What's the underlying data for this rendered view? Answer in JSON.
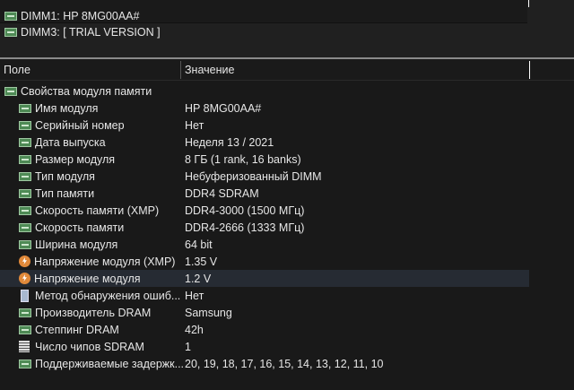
{
  "devices": [
    {
      "label": "DIMM1: HP 8MG00AA#"
    },
    {
      "label": "DIMM3: [ TRIAL VERSION ]"
    }
  ],
  "header": {
    "field": "Поле",
    "value": "Значение"
  },
  "group": {
    "label": "Свойства модуля памяти"
  },
  "rows": [
    {
      "field": "Имя модуля",
      "value": "HP 8MG00AA#",
      "icon": "memory-module-icon"
    },
    {
      "field": "Серийный номер",
      "value": "Нет",
      "icon": "memory-module-icon"
    },
    {
      "field": "Дата выпуска",
      "value": "Неделя 13 / 2021",
      "icon": "memory-module-icon"
    },
    {
      "field": "Размер модуля",
      "value": "8 ГБ (1 rank, 16 banks)",
      "icon": "memory-module-icon"
    },
    {
      "field": "Тип модуля",
      "value": "Небуферизованный DIMM",
      "icon": "memory-module-icon"
    },
    {
      "field": "Тип памяти",
      "value": "DDR4 SDRAM",
      "icon": "memory-module-icon"
    },
    {
      "field": "Скорость памяти (XMP)",
      "value": "DDR4-3000 (1500 МГц)",
      "icon": "memory-module-icon"
    },
    {
      "field": "Скорость памяти",
      "value": "DDR4-2666 (1333 МГц)",
      "icon": "memory-module-icon"
    },
    {
      "field": "Ширина модуля",
      "value": "64 bit",
      "icon": "memory-module-icon"
    },
    {
      "field": "Напряжение модуля (XMP)",
      "value": "1.35 V",
      "icon": "voltage-icon"
    },
    {
      "field": "Напряжение модуля",
      "value": "1.2 V",
      "icon": "voltage-icon",
      "selected": true
    },
    {
      "field": "Метод обнаружения ошиб...",
      "value": "Нет",
      "icon": "ecc-icon"
    },
    {
      "field": "Производитель DRAM",
      "value": "Samsung",
      "icon": "memory-module-icon"
    },
    {
      "field": "Степпинг DRAM",
      "value": "42h",
      "icon": "memory-module-icon"
    },
    {
      "field": "Число чипов SDRAM",
      "value": "1",
      "icon": "chip-icon"
    },
    {
      "field": "Поддерживаемые задержк...",
      "value": "20, 19, 18, 17, 16, 15, 14, 13, 12, 11, 10",
      "icon": "memory-module-icon"
    }
  ]
}
